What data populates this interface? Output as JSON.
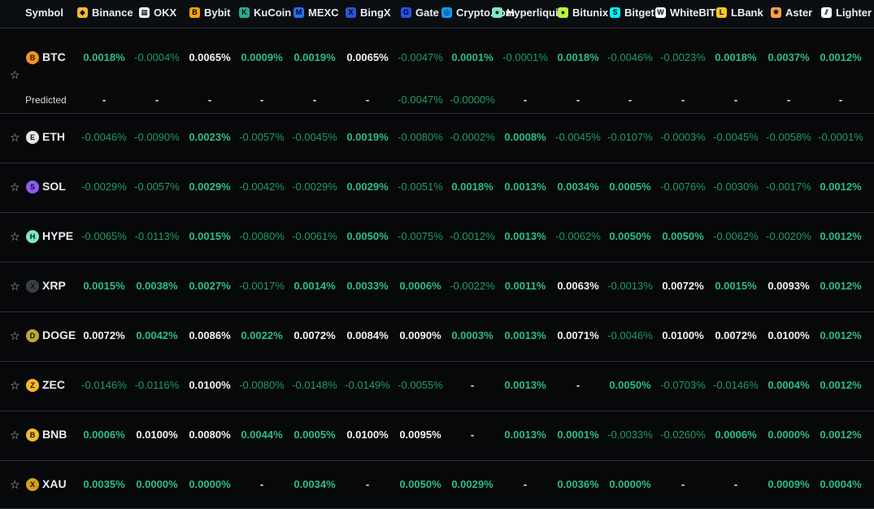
{
  "header": {
    "symbol_label": "Symbol",
    "exchanges": [
      "Binance",
      "OKX",
      "Bybit",
      "KuCoin",
      "MEXC",
      "BingX",
      "Gate",
      "Crypto.com",
      "Hyperliqui",
      "Bitunix",
      "Bitget",
      "WhiteBIT",
      "LBank",
      "Aster",
      "Lighter"
    ]
  },
  "rows": [
    {
      "symbol": "BTC",
      "coin_color": "#f7931a",
      "values": [
        "0.0018%",
        "-0.0004%",
        "0.0065%",
        "0.0009%",
        "0.0019%",
        "0.0065%",
        "-0.0047%",
        "0.0001%",
        "-0.0001%",
        "0.0018%",
        "-0.0046%",
        "-0.0023%",
        "0.0018%",
        "0.0037%",
        "0.0012%"
      ],
      "predicted_label": "Predicted",
      "predicted": [
        "-",
        "-",
        "-",
        "-",
        "-",
        "-",
        "-0.0047%",
        "-0.0000%",
        "-",
        "-",
        "-",
        "-",
        "-",
        "-",
        "-"
      ]
    },
    {
      "symbol": "ETH",
      "coin_color": "#e6e6e6",
      "values": [
        "-0.0046%",
        "-0.0090%",
        "0.0023%",
        "-0.0057%",
        "-0.0045%",
        "0.0019%",
        "-0.0080%",
        "-0.0002%",
        "0.0008%",
        "-0.0045%",
        "-0.0107%",
        "-0.0003%",
        "-0.0045%",
        "-0.0058%",
        "-0.0001%"
      ]
    },
    {
      "symbol": "SOL",
      "coin_color": "#8a5cf6",
      "values": [
        "-0.0029%",
        "-0.0057%",
        "0.0029%",
        "-0.0042%",
        "-0.0029%",
        "0.0029%",
        "-0.0051%",
        "0.0018%",
        "0.0013%",
        "0.0034%",
        "0.0005%",
        "-0.0076%",
        "-0.0030%",
        "-0.0017%",
        "0.0012%"
      ]
    },
    {
      "symbol": "HYPE",
      "coin_color": "#7ee8c0",
      "values": [
        "-0.0065%",
        "-0.0113%",
        "0.0015%",
        "-0.0080%",
        "-0.0061%",
        "0.0050%",
        "-0.0075%",
        "-0.0012%",
        "0.0013%",
        "-0.0062%",
        "0.0050%",
        "0.0050%",
        "-0.0062%",
        "-0.0020%",
        "0.0012%"
      ]
    },
    {
      "symbol": "XRP",
      "coin_color": "#3a3f46",
      "values": [
        "0.0015%",
        "0.0038%",
        "0.0027%",
        "-0.0017%",
        "0.0014%",
        "0.0033%",
        "0.0006%",
        "-0.0022%",
        "0.0011%",
        "0.0063%",
        "-0.0013%",
        "0.0072%",
        "0.0015%",
        "0.0093%",
        "0.0012%"
      ]
    },
    {
      "symbol": "DOGE",
      "coin_color": "#c2a633",
      "values": [
        "0.0072%",
        "0.0042%",
        "0.0086%",
        "0.0022%",
        "0.0072%",
        "0.0084%",
        "0.0090%",
        "0.0003%",
        "0.0013%",
        "0.0071%",
        "-0.0046%",
        "0.0100%",
        "0.0072%",
        "0.0100%",
        "0.0012%"
      ]
    },
    {
      "symbol": "ZEC",
      "coin_color": "#f4b728",
      "values": [
        "-0.0146%",
        "-0.0116%",
        "0.0100%",
        "-0.0080%",
        "-0.0148%",
        "-0.0149%",
        "-0.0055%",
        "-",
        "0.0013%",
        "-",
        "0.0050%",
        "-0.0703%",
        "-0.0146%",
        "0.0004%",
        "0.0012%"
      ]
    },
    {
      "symbol": "BNB",
      "coin_color": "#f3ba2f",
      "values": [
        "0.0006%",
        "0.0100%",
        "0.0080%",
        "0.0044%",
        "0.0005%",
        "0.0100%",
        "0.0095%",
        "-",
        "0.0013%",
        "0.0001%",
        "-0.0033%",
        "-0.0260%",
        "0.0006%",
        "0.0000%",
        "0.0012%"
      ]
    },
    {
      "symbol": "XAU",
      "coin_color": "#d4a017",
      "values": [
        "0.0035%",
        "0.0000%",
        "0.0000%",
        "-",
        "0.0034%",
        "-",
        "0.0050%",
        "0.0029%",
        "-",
        "0.0036%",
        "0.0000%",
        "-",
        "-",
        "0.0009%",
        "0.0004%"
      ]
    }
  ],
  "colors": {
    "positive": "#2ebd85",
    "negative": "#1f9d63",
    "neutral": "#f2f2f2",
    "background": "#07080a"
  }
}
